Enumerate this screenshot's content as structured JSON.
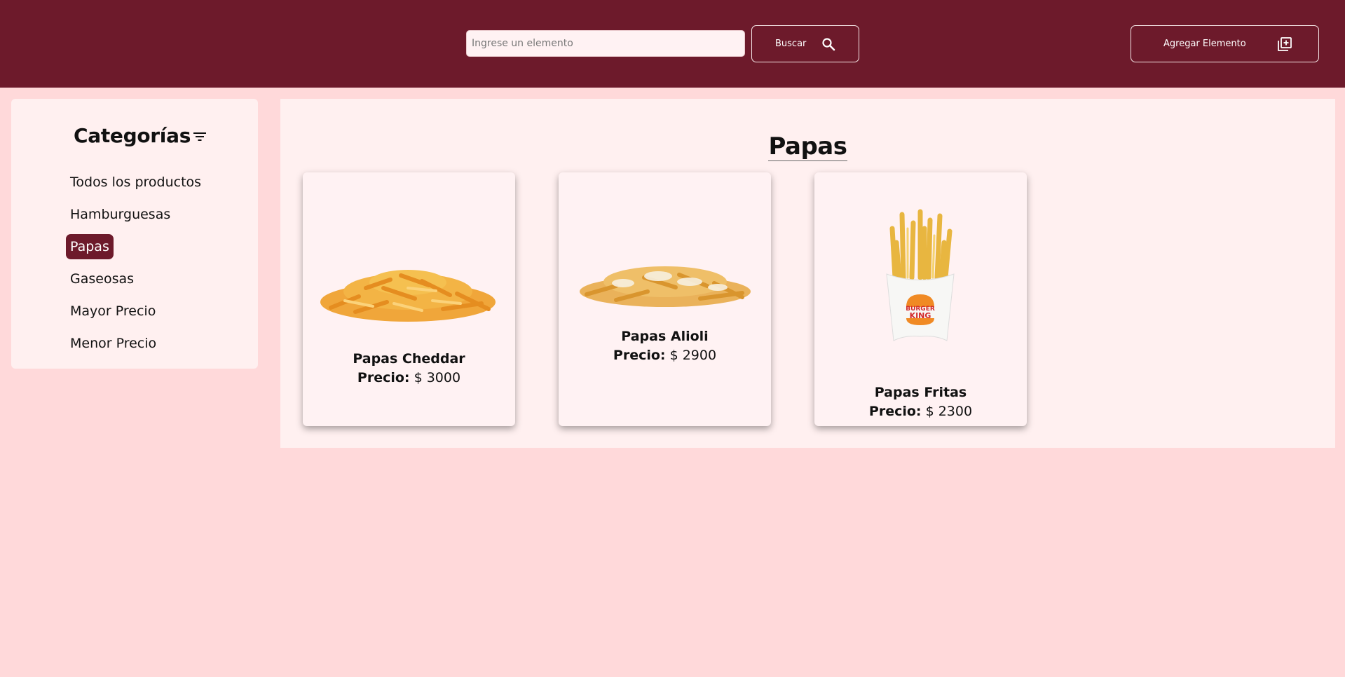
{
  "header": {
    "search": {
      "placeholder": "Ingrese un elemento",
      "value": ""
    },
    "search_button_label": "Buscar",
    "add_button_label": "Agregar Elemento"
  },
  "sidebar": {
    "title": "Categorías",
    "items": [
      {
        "label": "Todos los productos",
        "active": false
      },
      {
        "label": "Hamburguesas",
        "active": false
      },
      {
        "label": "Papas",
        "active": true
      },
      {
        "label": "Gaseosas",
        "active": false
      },
      {
        "label": "Mayor Precio",
        "active": false
      },
      {
        "label": "Menor Precio",
        "active": false
      }
    ]
  },
  "main": {
    "title": "Papas",
    "price_label": "Precio:",
    "products": [
      {
        "name": "Papas Cheddar",
        "price": "$ 3000",
        "image": "cheddar-fries-image"
      },
      {
        "name": "Papas Alioli",
        "price": "$ 2900",
        "image": "alioli-fries-image"
      },
      {
        "name": "Papas Fritas",
        "price": "$ 2300",
        "image": "burger-king-fries-image"
      }
    ]
  },
  "brand_logo_text": "BURGER KING",
  "colors": {
    "primary": "#6d1a2b",
    "background": "#ffd9da",
    "panel": "#fff0f0",
    "card": "#fff2f3"
  }
}
